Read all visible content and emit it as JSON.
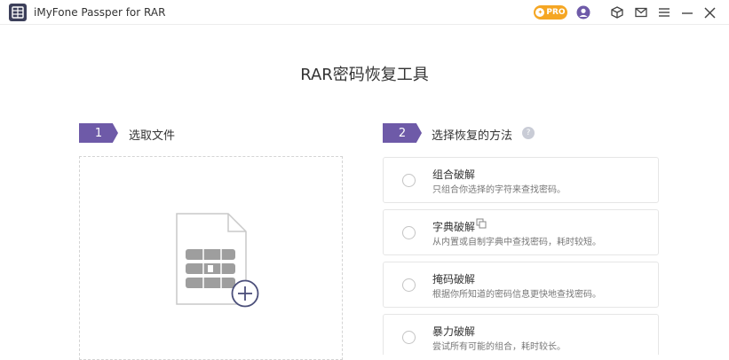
{
  "window": {
    "title": "iMyFone Passper for RAR",
    "pro_label": "PRO"
  },
  "page": {
    "title": "RAR密码恢复工具"
  },
  "steps": [
    {
      "number": "1",
      "label": "选取文件"
    },
    {
      "number": "2",
      "label": "选择恢复的方法"
    }
  ],
  "methods": [
    {
      "title": "组合破解",
      "desc": "只组合你选择的字符来查找密码。"
    },
    {
      "title": "字典破解",
      "desc": "从内置或自制字典中查找密码，耗时较短。"
    },
    {
      "title": "掩码破解",
      "desc": "根据你所知道的密码信息更快地查找密码。"
    },
    {
      "title": "暴力破解",
      "desc": "尝试所有可能的组合，耗时较长。"
    }
  ],
  "colors": {
    "accent": "#6e5aa8",
    "pro": "#f5a623"
  },
  "icons": [
    "app-logo-icon",
    "pro-badge-icon",
    "account-icon",
    "cube-icon",
    "mail-icon",
    "menu-icon",
    "minimize-icon",
    "close-icon",
    "help-icon",
    "copy-icon",
    "rar-file-icon",
    "add-icon"
  ]
}
